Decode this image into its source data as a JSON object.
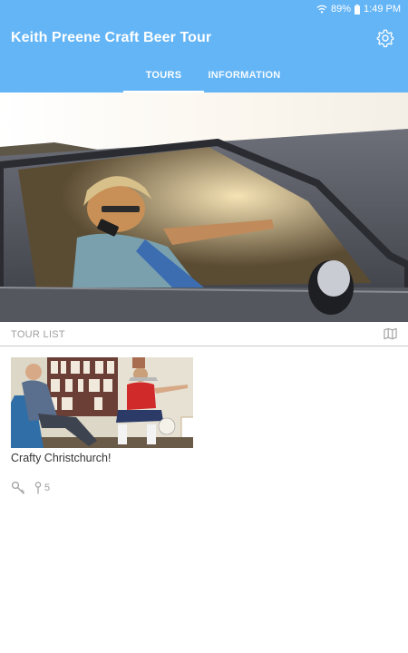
{
  "status_bar": {
    "battery": "89%",
    "time": "1:49 PM"
  },
  "app_bar": {
    "title": "Keith Preene Craft Beer Tour"
  },
  "tabs": [
    {
      "label": "TOURS",
      "active": true
    },
    {
      "label": "INFORMATION",
      "active": false
    }
  ],
  "icons": {
    "settings": "gear-icon",
    "map": "map-icon",
    "search": "key-icon",
    "pin": "pin-icon"
  },
  "section": {
    "title": "TOUR LIST"
  },
  "tours": [
    {
      "title": "Crafty Christchurch!",
      "stop_count": "5"
    }
  ],
  "colors": {
    "app_bar": "#64b5f6",
    "muted_text": "#9e9e9e"
  }
}
